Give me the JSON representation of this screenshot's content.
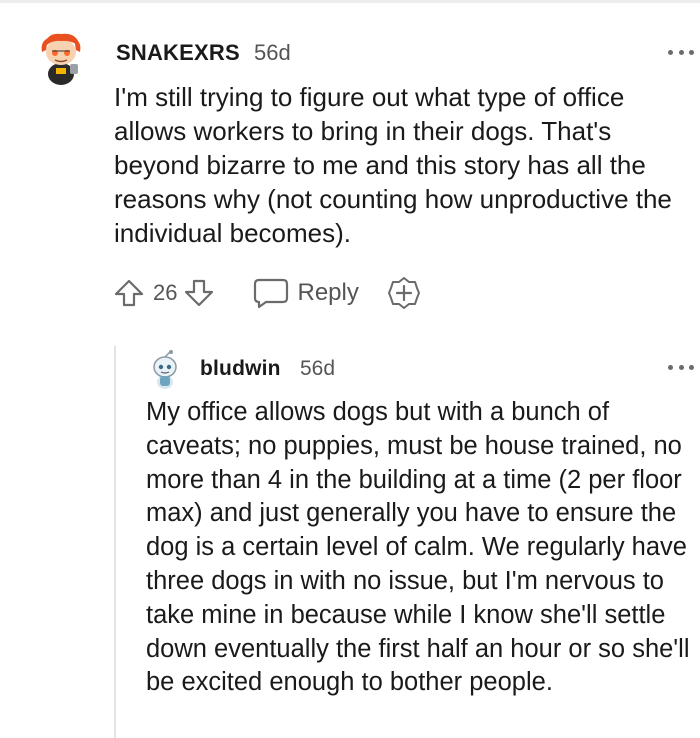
{
  "parent_comment": {
    "username": "SNAKEXRS",
    "age": "56d",
    "body": "I'm still trying to figure out what type of office allows workers to bring in their dogs. That's beyond bizarre to me and this story has all the reasons why (not counting how unproductive the individual becomes).",
    "votes": "26",
    "reply_label": "Reply",
    "icons": {
      "avatar": "user-avatar-icon",
      "upvote": "upvote-arrow-icon",
      "downvote": "downvote-arrow-icon",
      "reply": "chat-bubble-icon",
      "award": "award-plus-icon",
      "more": "more-dots-icon"
    }
  },
  "reply_comment": {
    "username": "bludwin",
    "age": "56d",
    "body": "My office allows dogs but with a bunch of caveats; no puppies, must be house trained, no more than 4 in the building at a time (2 per floor max) and just generally you have to ensure the dog is a certain level of calm. We regularly have three dogs in with no issue, but I'm nervous to take mine in because while I know she'll settle down eventually the first half an hour or so she'll be excited enough to bother people.",
    "icons": {
      "avatar": "user-avatar-icon",
      "more": "more-dots-icon"
    }
  },
  "colors": {
    "text": "#1a1a1b",
    "meta": "#555555",
    "icon": "#6b6b6b",
    "thread_line": "#e4e4e4"
  }
}
